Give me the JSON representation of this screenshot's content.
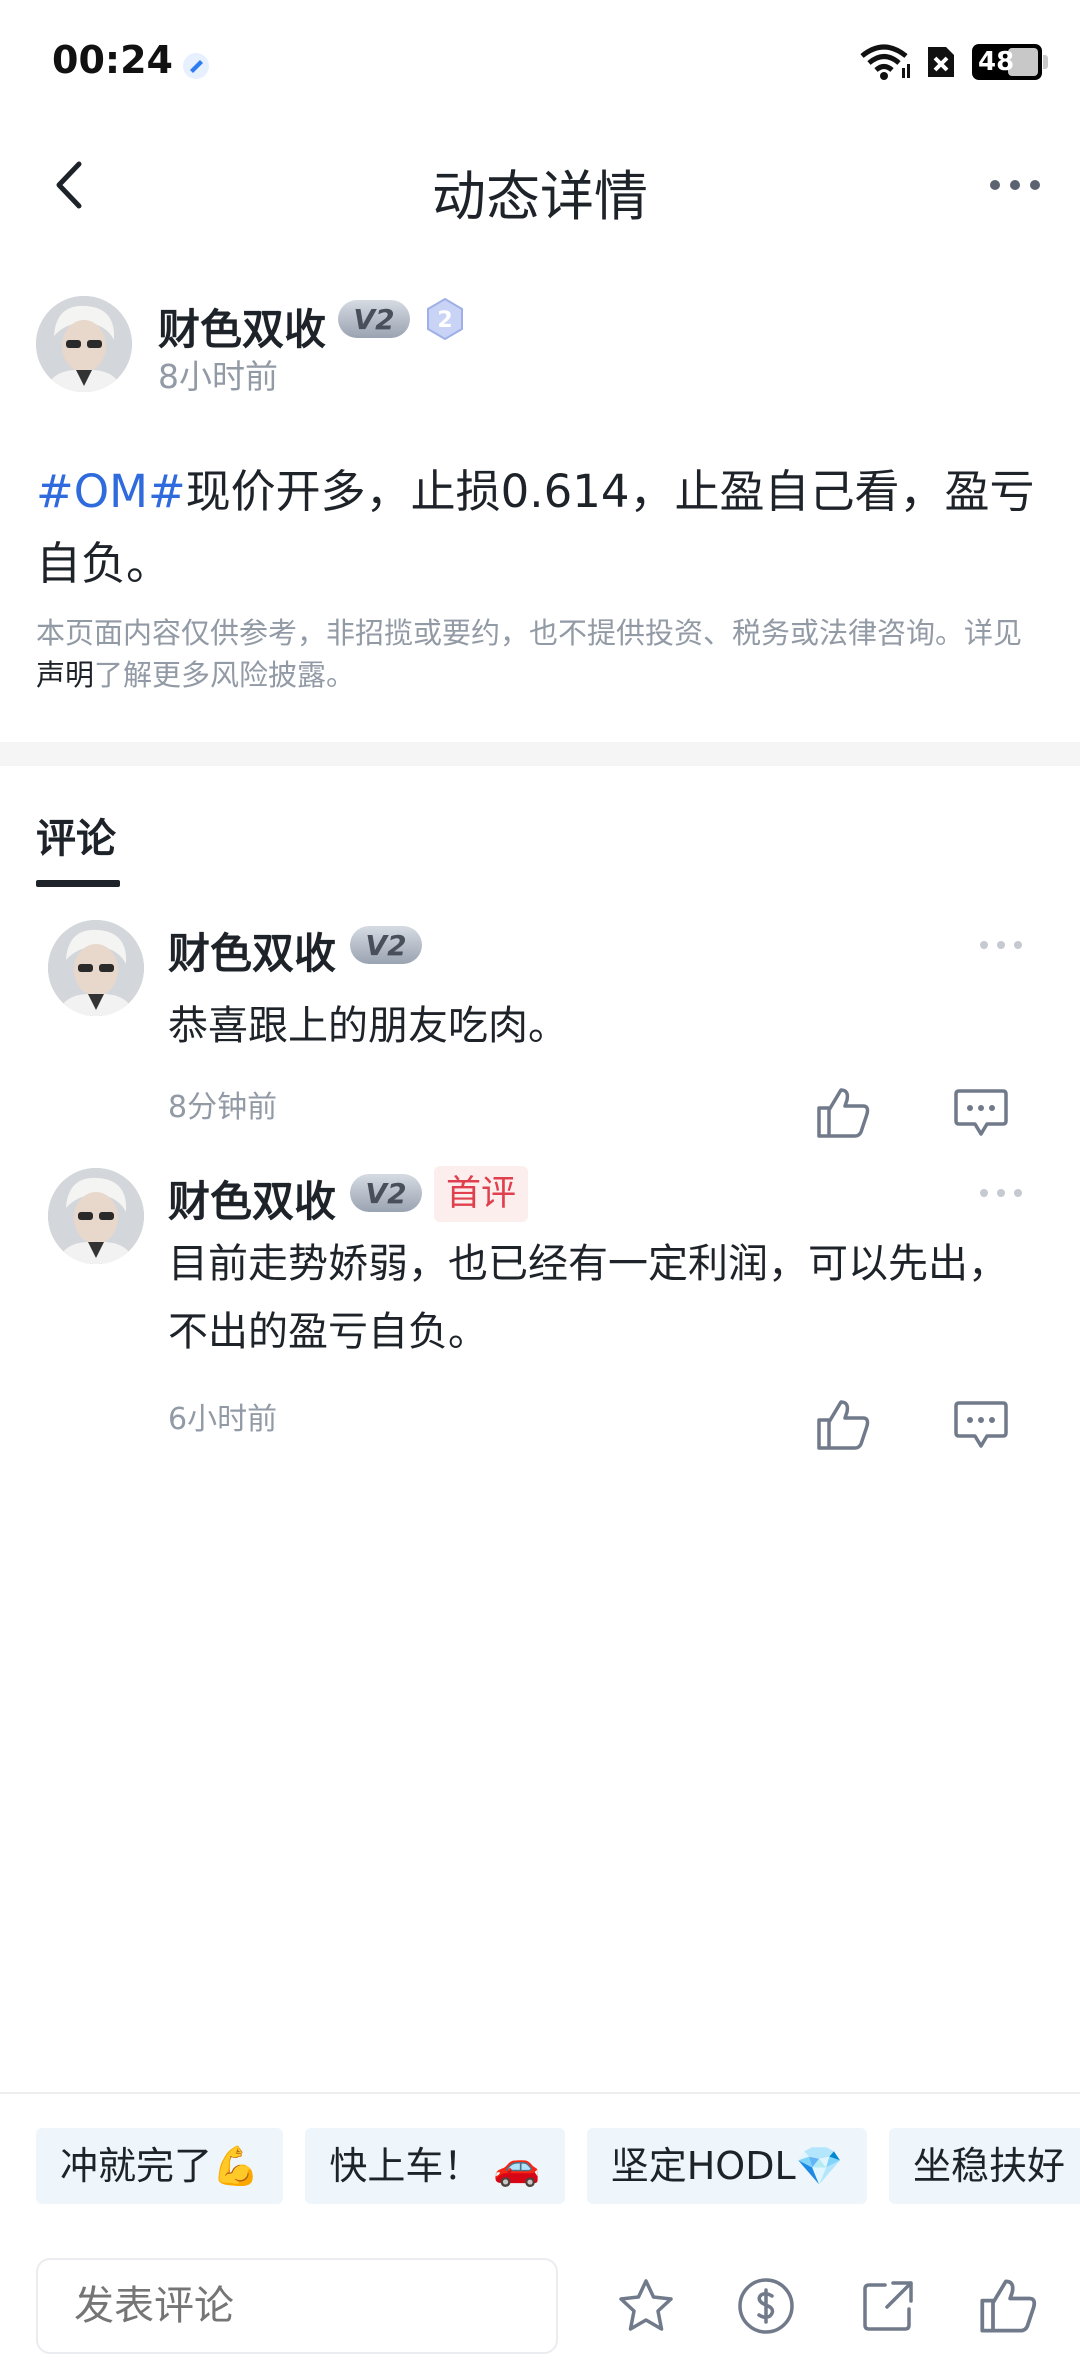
{
  "status_bar": {
    "time": "00:24",
    "battery": "48"
  },
  "header": {
    "title": "动态详情"
  },
  "post": {
    "author": {
      "name": "财色双收",
      "v_badge": "V2",
      "level": "2"
    },
    "time": "8小时前",
    "hashtag": "#OM#",
    "content": "现价开多，止损0.614，止盈自己看，盈亏自负。",
    "disclaimer_prefix": "本页面内容仅供参考，非招揽或要约，也不提供投资、税务或法律咨询。详见",
    "disclaimer_link": "声明",
    "disclaimer_suffix": "了解更多风险披露。"
  },
  "comments_tab": {
    "label": "评论"
  },
  "comments": [
    {
      "author": "财色双收",
      "v_badge": "V2",
      "text": "恭喜跟上的朋友吃肉。",
      "time": "8分钟前"
    },
    {
      "author": "财色双收",
      "v_badge": "V2",
      "badge": "首评",
      "text": "目前走势娇弱，也已经有一定利润，可以先出，不出的盈亏自负。",
      "time": "6小时前"
    }
  ],
  "quick_replies": [
    "冲就完了💪",
    "快上车！ 🚗",
    "坚定HODL💎",
    "坐稳扶好"
  ],
  "bottom_bar": {
    "input_placeholder": "发表评论",
    "icons": [
      "star-icon",
      "coin-icon",
      "share-icon",
      "like-icon"
    ]
  },
  "colors": {
    "hashtag": "#2f6bdc",
    "first_badge": "#e0404e",
    "muted": "#929aa5"
  }
}
